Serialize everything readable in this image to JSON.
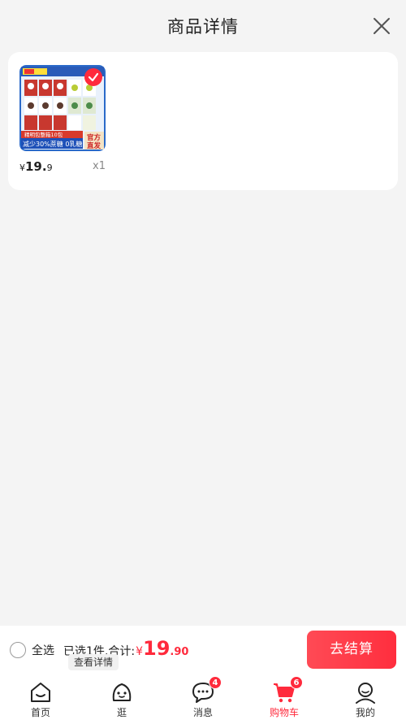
{
  "header": {
    "title": "商品详情"
  },
  "product": {
    "price_yen": "¥",
    "price_int": "19.",
    "price_dec": "9",
    "quantity": "x1",
    "image_texts": {
      "banner_bottom": "减少30%蔗糖 0乳糖",
      "banner_top": "精明包整箱10包",
      "corner_tag_1": "官方",
      "corner_tag_2": "直发"
    },
    "selected": true
  },
  "checkout": {
    "select_all_label": "全选",
    "summary_text": "已选1件,合计:",
    "currency": "¥",
    "total_int": "19",
    "total_dec": ".90",
    "detail_link": "查看详情",
    "pay_button": "去结算"
  },
  "tabbar": {
    "items": [
      {
        "label": "首页",
        "icon": "home-icon"
      },
      {
        "label": "逛",
        "icon": "browse-face-icon"
      },
      {
        "label": "消息",
        "icon": "message-icon",
        "badge": "4"
      },
      {
        "label": "购物车",
        "icon": "cart-icon",
        "badge": "6",
        "active": true
      },
      {
        "label": "我的",
        "icon": "profile-icon"
      }
    ]
  },
  "colors": {
    "accent": "#ff2a3c",
    "background": "#f4f4f4"
  }
}
